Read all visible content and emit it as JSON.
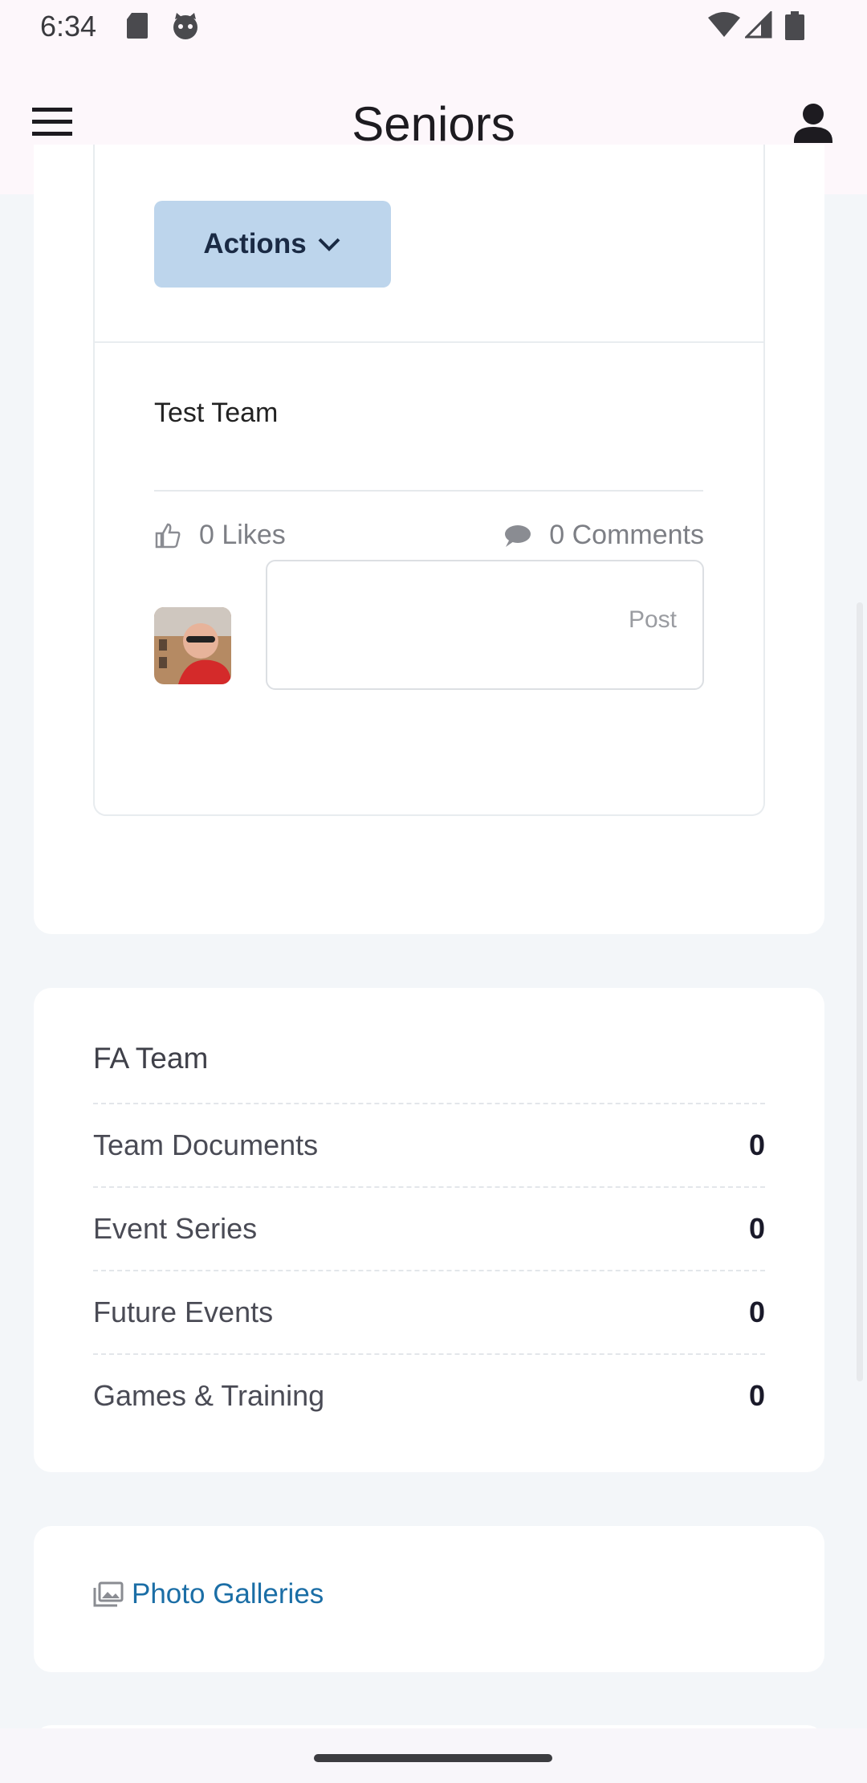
{
  "status_bar": {
    "time": "6:34"
  },
  "app_bar": {
    "title": "Seniors"
  },
  "post": {
    "actions_label": "Actions",
    "text": "Test Team",
    "likes": "0 Likes",
    "comments": "0 Comments",
    "comment_button": "Post"
  },
  "team": {
    "title": "FA Team",
    "rows": [
      {
        "label": "Team Documents",
        "value": "0"
      },
      {
        "label": "Event Series",
        "value": "0"
      },
      {
        "label": "Future Events",
        "value": "0"
      },
      {
        "label": "Games & Training",
        "value": "0"
      }
    ]
  },
  "gallery": {
    "label": "Photo Galleries"
  },
  "colors": {
    "accent": "#1b6ea6",
    "actions_bg": "#bdd5ec",
    "app_bar_bg": "#fdf7fb"
  },
  "icons": [
    "menu-icon",
    "account-icon",
    "thumb-up-icon",
    "comment-icon",
    "gallery-icon",
    "chevron-down-icon",
    "sd-card-icon",
    "cat-icon",
    "wifi-icon",
    "signal-icon",
    "battery-icon"
  ]
}
